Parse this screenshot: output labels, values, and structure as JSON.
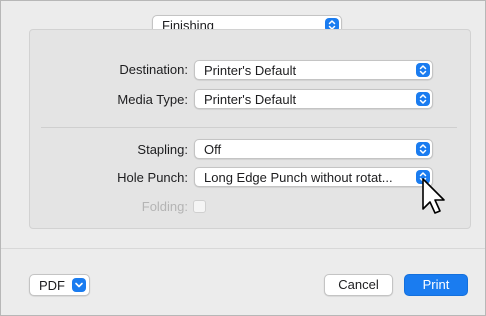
{
  "section_popup": {
    "value": "Finishing"
  },
  "output": {
    "destination": {
      "label": "Destination:",
      "value": "Printer's Default"
    },
    "media_type": {
      "label": "Media Type:",
      "value": "Printer's Default"
    }
  },
  "finishing": {
    "stapling": {
      "label": "Stapling:",
      "value": "Off"
    },
    "hole_punch": {
      "label": "Hole Punch:",
      "value": "Long Edge Punch without rotat..."
    },
    "folding": {
      "label": "Folding:",
      "checked": false,
      "enabled": false
    }
  },
  "footer": {
    "pdf_label": "PDF",
    "cancel_label": "Cancel",
    "print_label": "Print"
  },
  "colors": {
    "accent": "#1a7cf0",
    "dialog_bg": "#ececec",
    "panel_bg": "#e4e4e4",
    "disabled_text": "#b4b4b4"
  },
  "icons": {
    "popup_arrows": "up-down-chevron-icon",
    "pdf_arrow": "chevron-down-icon",
    "cursor": "mouse-pointer-icon"
  }
}
